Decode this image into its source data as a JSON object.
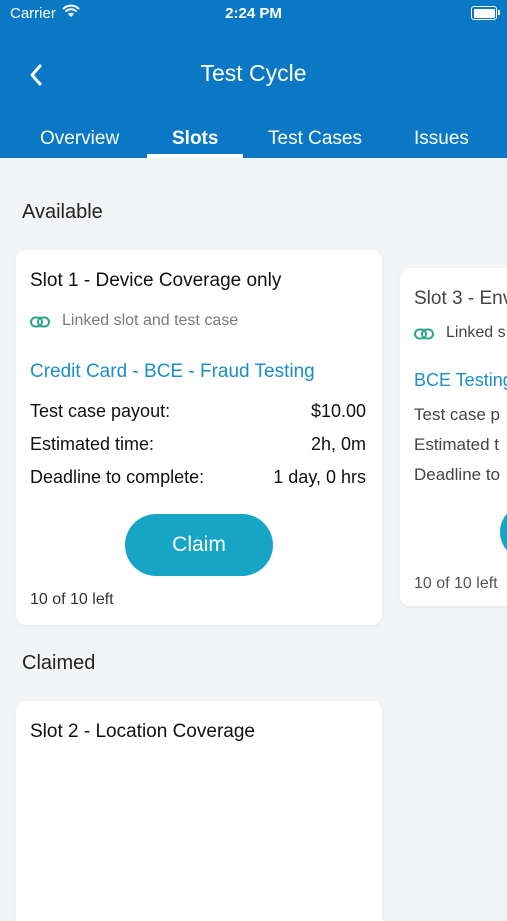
{
  "status_bar": {
    "carrier": "Carrier",
    "time": "2:24 PM"
  },
  "header": {
    "title": "Test Cycle"
  },
  "tabs": [
    {
      "label": "Overview",
      "active": false
    },
    {
      "label": "Slots",
      "active": true
    },
    {
      "label": "Test Cases",
      "active": false
    },
    {
      "label": "Issues",
      "active": false
    }
  ],
  "sections": {
    "available": "Available",
    "claimed": "Claimed"
  },
  "available_slots": [
    {
      "title": "Slot 1 - Device Coverage only",
      "linked_label": "Linked slot and test case",
      "test_case": "Credit Card - BCE - Fraud Testing",
      "payout_label": "Test case payout:",
      "payout_value": "$10.00",
      "time_label": "Estimated time:",
      "time_value": "2h, 0m",
      "deadline_label": "Deadline to complete:",
      "deadline_value": "1 day, 0 hrs",
      "claim_label": "Claim",
      "remaining": "10 of 10 left"
    },
    {
      "title": "Slot 3 - Env",
      "linked_label": "Linked s",
      "test_case": "BCE Testing",
      "payout_label": "Test case p",
      "time_label": "Estimated t",
      "deadline_label": "Deadline to",
      "remaining": "10 of 10 left"
    }
  ],
  "claimed_slots": [
    {
      "title": "Slot 2 - Location Coverage"
    }
  ],
  "colors": {
    "header": "#0a78c4",
    "accent": "#17a5c6",
    "link": "#1a8ec6",
    "link_icon": "#2aa58a"
  }
}
